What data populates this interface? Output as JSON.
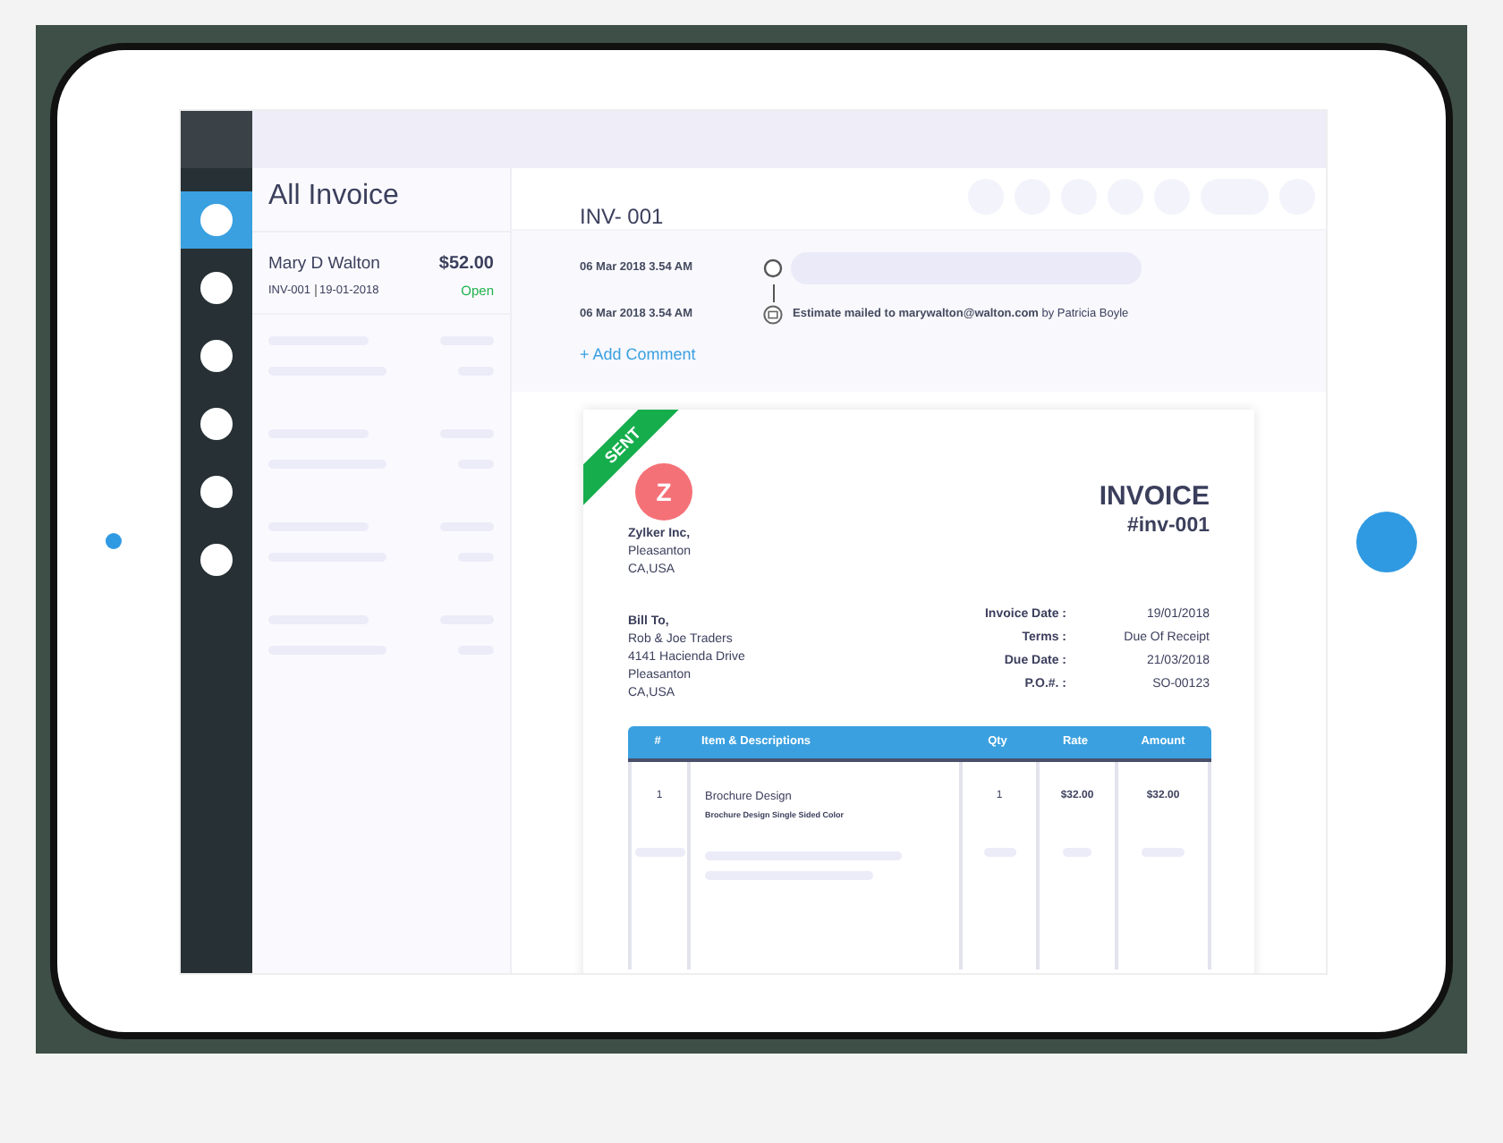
{
  "sidebar": {
    "items": [
      {
        "selected": true
      },
      {
        "selected": false
      },
      {
        "selected": false
      },
      {
        "selected": false
      },
      {
        "selected": false
      },
      {
        "selected": false
      }
    ]
  },
  "list": {
    "title": "All Invoice",
    "items": [
      {
        "customer": "Mary D Walton",
        "amount": "$52.00",
        "number": "INV-001",
        "date": "19-01-2018",
        "status": "Open"
      }
    ]
  },
  "detail": {
    "title": "INV- 001",
    "timeline": [
      {
        "kind": "placeholder",
        "time": "06 Mar 2018 3.54 AM"
      },
      {
        "kind": "email",
        "time": "06 Mar 2018 3.54 AM",
        "text": "**Estimate mailed to marywalton@walton.com** by Patricia Boyle"
      }
    ],
    "add_comment": "+ Add Comment",
    "invoice": {
      "status_ribbon": "SENT",
      "logo_letter": "Z",
      "company": [
        "Zylker Inc,",
        "Pleasanton",
        "CA,USA"
      ],
      "title": "INVOICE",
      "number": "#inv-001",
      "bill_to": [
        "Bill To,",
        "Rob & Joe Traders",
        "4141 Hacienda Drive",
        "Pleasanton",
        "CA,USA"
      ],
      "meta": [
        {
          "label": "Invoice Date :",
          "value": "19/01/2018"
        },
        {
          "label": "Terms :",
          "value": "Due Of Receipt"
        },
        {
          "label": "Due Date :",
          "value": "21/03/2018"
        },
        {
          "label": "P.O.#. :",
          "value": "SO-00123"
        }
      ],
      "table": {
        "columns": [
          "#",
          "Item & Descriptions",
          "Qty",
          "Rate",
          "Amount"
        ],
        "rows": [
          {
            "index": "1",
            "item": "Brochure Design",
            "description": "Brochure Design Single Sided Color",
            "qty": "1",
            "rate": "$32.00",
            "amount": "$32.00"
          }
        ]
      }
    }
  }
}
